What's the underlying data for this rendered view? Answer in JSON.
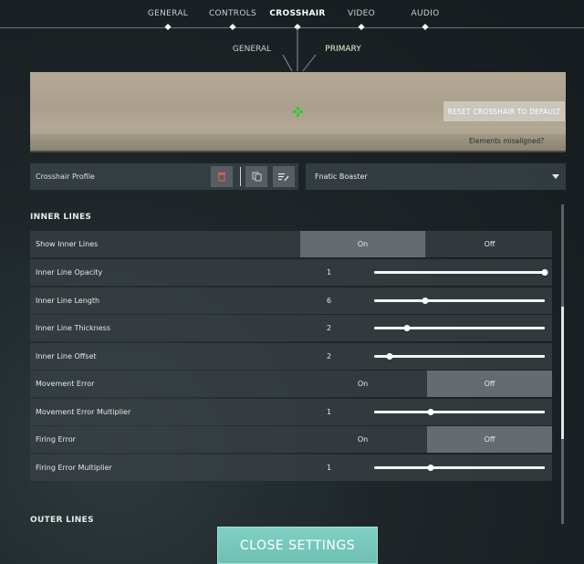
{
  "nav": {
    "tabs": [
      {
        "label": "GENERAL"
      },
      {
        "label": "CONTROLS"
      },
      {
        "label": "CROSSHAIR"
      },
      {
        "label": "VIDEO"
      },
      {
        "label": "AUDIO"
      }
    ],
    "active_tab": "CROSSHAIR",
    "subtabs": [
      {
        "label": "GENERAL"
      },
      {
        "label": "PRIMARY"
      }
    ],
    "active_subtab": "PRIMARY"
  },
  "preview": {
    "reset_label": "RESET CROSSHAIR TO DEFAULT",
    "misaligned_label": "Elements misaligned?",
    "crosshair_color": "#2ccc3a"
  },
  "profile": {
    "label": "Crosshair Profile",
    "selected": "Fnatic Boaster",
    "icons": [
      "delete-icon",
      "copy-icon",
      "rename-icon",
      "chevron-down-icon"
    ]
  },
  "sections": {
    "inner_lines_title": "INNER LINES",
    "outer_lines_title": "OUTER LINES"
  },
  "settings": {
    "show_inner_lines": {
      "label": "Show Inner Lines",
      "on": "On",
      "off": "Off",
      "selected": "On"
    },
    "inner_line_opacity": {
      "label": "Inner Line Opacity",
      "value": "1",
      "fraction": 1.0
    },
    "inner_line_length": {
      "label": "Inner Line Length",
      "value": "6",
      "fraction": 0.3
    },
    "inner_line_thickness": {
      "label": "Inner Line Thickness",
      "value": "2",
      "fraction": 0.19
    },
    "inner_line_offset": {
      "label": "Inner Line Offset",
      "value": "2",
      "fraction": 0.09
    },
    "movement_error": {
      "label": "Movement Error",
      "on": "On",
      "off": "Off",
      "selected": "Off"
    },
    "movement_error_multiplier": {
      "label": "Movement Error Multiplier",
      "value": "1",
      "fraction": 0.33
    },
    "firing_error": {
      "label": "Firing Error",
      "on": "On",
      "off": "Off",
      "selected": "Off"
    },
    "firing_error_multiplier": {
      "label": "Firing Error Multiplier",
      "value": "1",
      "fraction": 0.33
    }
  },
  "footer": {
    "close_label": "CLOSE SETTINGS"
  },
  "colors": {
    "accent": "#75c8bb",
    "crosshair": "#2ccc3a"
  }
}
